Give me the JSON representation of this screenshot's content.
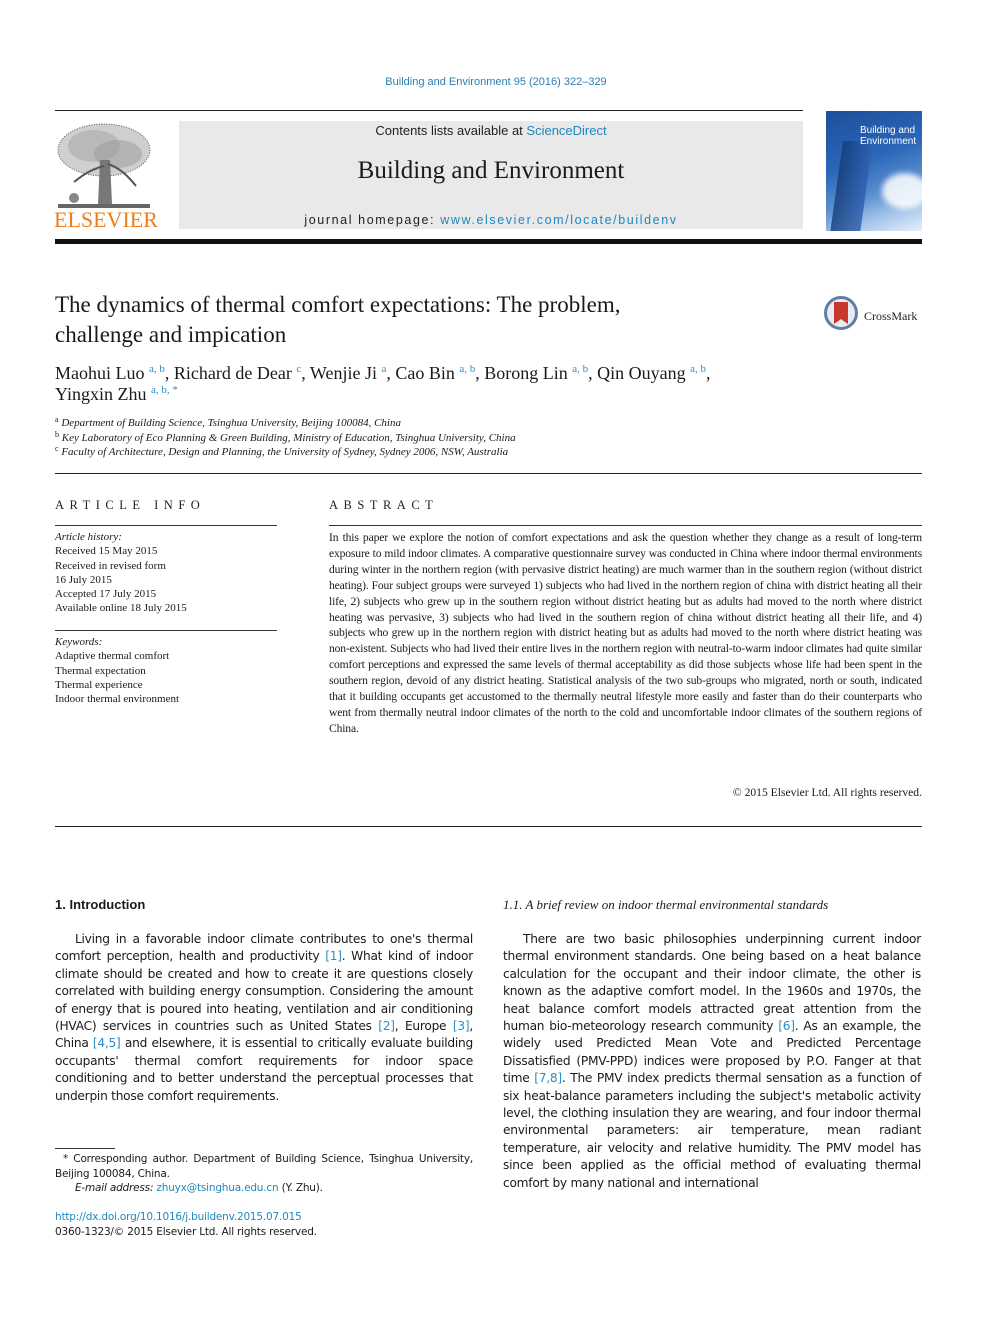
{
  "header": {
    "journal_reference": "Building and Environment 95 (2016) 322–329",
    "publisher_logo_text": "ELSEVIER",
    "contents_prefix": "Contents lists available at ",
    "contents_link": "ScienceDirect",
    "journal_title": "Building and Environment",
    "homepage_prefix": "journal homepage: ",
    "homepage_link": "www.elsevier.com/locate/buildenv",
    "cover_title_line1": "Building and",
    "cover_title_line2": "Environment",
    "crossmark_label": "CrossMark"
  },
  "article": {
    "title_line1": "The dynamics of thermal comfort expectations: The problem,",
    "title_line2": "challenge and impication",
    "authors": [
      {
        "name": "Maohui Luo",
        "affil": "a, b",
        "sep": ", "
      },
      {
        "name": "Richard de Dear",
        "affil": "c",
        "sep": ", "
      },
      {
        "name": "Wenjie Ji",
        "affil": "a",
        "sep": ", "
      },
      {
        "name": "Cao Bin",
        "affil": "a, b",
        "sep": ", "
      },
      {
        "name": "Borong Lin",
        "affil": "a, b",
        "sep": ", "
      },
      {
        "name": "Qin Ouyang",
        "affil": "a, b",
        "sep": ","
      },
      {
        "name": "Yingxin Zhu",
        "affil": "a, b, *",
        "sep": ""
      }
    ],
    "affiliations": [
      {
        "key": "a",
        "text": "Department of Building Science, Tsinghua University, Beijing 100084, China"
      },
      {
        "key": "b",
        "text": "Key Laboratory of Eco Planning & Green Building, Ministry of Education, Tsinghua University, China"
      },
      {
        "key": "c",
        "text": "Faculty of Architecture, Design and Planning, the University of Sydney, Sydney 2006, NSW, Australia"
      }
    ]
  },
  "article_info": {
    "heading": "ARTICLE INFO",
    "history_label": "Article history:",
    "history": [
      "Received 15 May 2015",
      "Received in revised form",
      "16 July 2015",
      "Accepted 17 July 2015",
      "Available online 18 July 2015"
    ],
    "keywords_label": "Keywords:",
    "keywords": [
      "Adaptive thermal comfort",
      "Thermal expectation",
      "Thermal experience",
      "Indoor thermal environment"
    ]
  },
  "abstract": {
    "heading": "ABSTRACT",
    "text": "In this paper we explore the notion of comfort expectations and ask the question whether they change as a result of long-term exposure to mild indoor climates. A comparative questionnaire survey was con­ducted in China where indoor thermal environments during winter in the northern region (with pervasive district heating) are much warmer than in the southern region (without district heating). Four subject groups were surveyed 1) subjects who had lived in the northern region of china with district heating all their life, 2) subjects who grew up in the southern region without district heating but as adults had moved to the north where district heating was pervasive, 3) subjects who had lived in the southern region of china without district heating all their life, and 4) subjects who grew up in the northern region with district heating but as adults had moved to the north where district heating was non-existent. Subjects who had lived their entire lives in the northern region with neutral-to-warm indoor climates had quite similar comfort perceptions and expressed the same levels of thermal acceptability as did those subjects whose life had been spent in the southern region, devoid of any district heating. Statistical analysis of the two sub-groups who migrated, north or south, indicated that it building occupants get accustomed to the thermally neutral lifestyle more easily and faster than do their counterparts who went from thermally neutral indoor climates of the north to the cold and uncom­fortable indoor climates of the southern regions of China.",
    "copyright": "© 2015 Elsevier Ltd. All rights reserved."
  },
  "introduction": {
    "heading": "1.  Introduction",
    "p1_a": "Living in a favorable indoor climate contributes to one's thermal comfort perception, health and productivity ",
    "ref1": "[1]",
    "p1_b": ". What kind of in­door climate should be created and how to create it are questions closely correlated with building energy consumption. Considering the amount of energy that is poured into heating, ventilation and air conditioning (HVAC) services in countries such as United States ",
    "ref2": "[2]",
    "p1_c": ", Europe ",
    "ref3": "[3]",
    "p1_d": ", China ",
    "ref4": "[4,5]",
    "p1_e": " and elsewhere, it is essential to critically evaluate building occupants' thermal comfort requirements for indoor space conditioning and to better understand the perceptual processes that underpin those comfort requirements."
  },
  "subsection": {
    "heading": "1.1.  A brief review on indoor thermal environmental standards",
    "p1_a": "There are two basic philosophies underpinning current indoor thermal environment standards. One being based on a heat balance calculation for the occupant and their indoor climate, the other is known as the adaptive comfort model. In the 1960s and 1970s, the heat balance comfort models attracted great attention from the human bio-meteorology research community ",
    "ref6": "[6]",
    "p1_b": ". As an example, the widely used Predicted Mean Vote and Predicted Percentage Dissatisfied (PMV-PPD) indices were proposed by P.O. Fanger at that time ",
    "ref7": "[7,8]",
    "p1_c": ". The PMV index predicts thermal sensation as a function of six heat-balance parameters including the subject's metabolic activity level, the clothing insulation they are wearing, and four indoor thermal environmental parameters: air tempera­ture, mean radiant temperature, air velocity and relative humidity. The PMV model has since been applied as the official method of evaluating thermal comfort by many national and international"
  },
  "footnotes": {
    "corresponding": "* Corresponding author. Department of Building Science, Tsinghua University, Beijing 100084, China.",
    "email_label": "E-mail address: ",
    "email": "zhuyx@tsinghua.edu.cn",
    "email_suffix": " (Y. Zhu).",
    "doi": "http://dx.doi.org/10.1016/j.buildenv.2015.07.015",
    "issn": "0360-1323/© 2015 Elsevier Ltd. All rights reserved."
  }
}
